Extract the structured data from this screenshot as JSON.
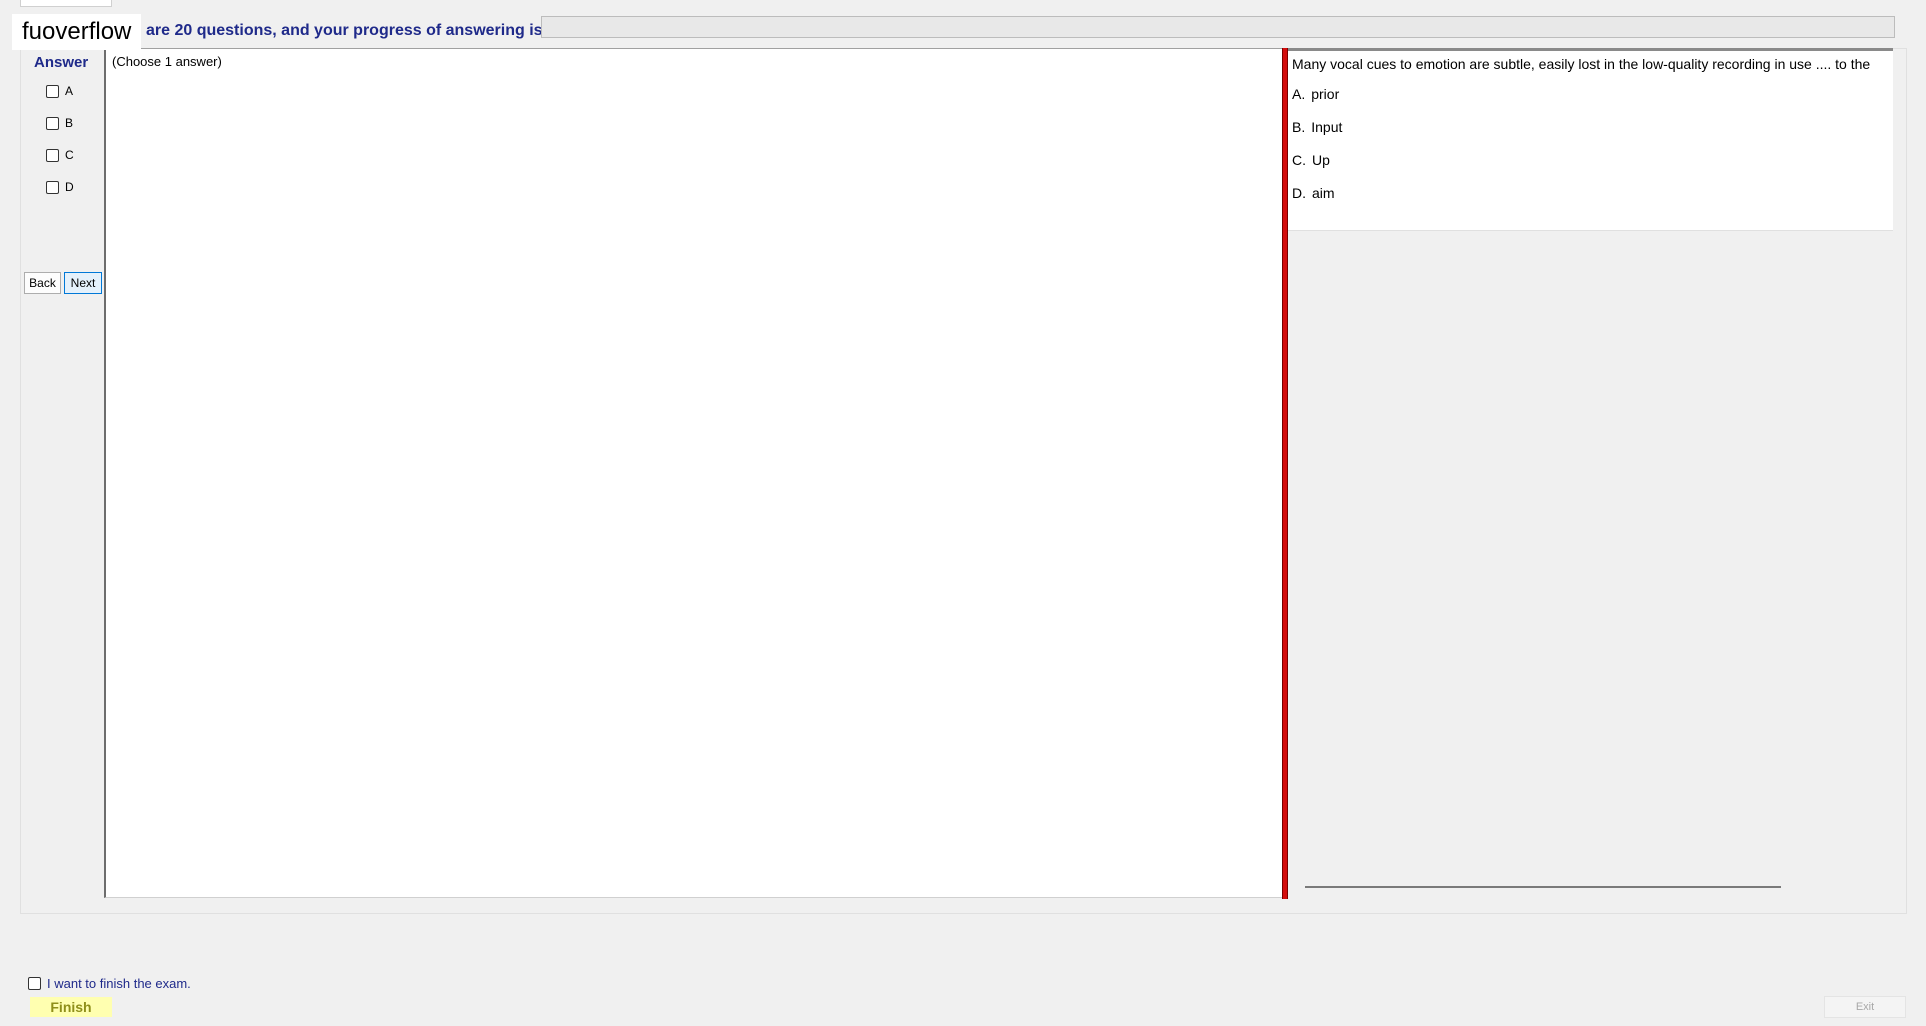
{
  "header": {
    "logo_text": "fuoverflow",
    "progress_text": "are 20 questions, and your progress of answering is",
    "progress_fraction": 0
  },
  "answer_panel": {
    "title": "Answer",
    "options": [
      "A",
      "B",
      "C",
      "D"
    ],
    "back_label": "Back",
    "next_label": "Next"
  },
  "question_area": {
    "hint": "(Choose 1 answer)"
  },
  "question_content": {
    "text": "Many vocal cues to emotion are subtle, easily lost in the low-quality recording in use .... to the",
    "choices": [
      {
        "letter": "A.",
        "text": "prior"
      },
      {
        "letter": "B.",
        "text": "Input"
      },
      {
        "letter": "C.",
        "text": "Up"
      },
      {
        "letter": "D.",
        "text": "aim"
      }
    ]
  },
  "footer": {
    "finish_checkbox_label": "I want to finish the exam.",
    "finish_label": "Finish",
    "exit_label": "Exit"
  },
  "colors": {
    "accent_text": "#1f2a8a",
    "splitter": "#d40d0d",
    "finish_bg": "#ffffb0"
  }
}
